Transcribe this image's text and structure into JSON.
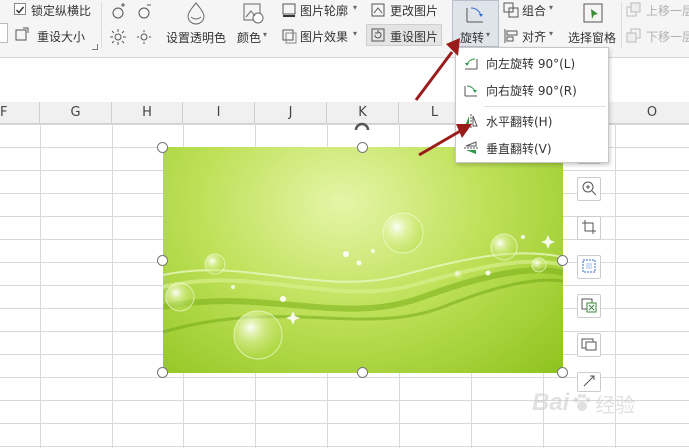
{
  "ribbon": {
    "lock_ratio_label": "锁定纵横比",
    "reset_size_label": "重设大小",
    "set_transparent_label": "设置透明色",
    "color_label": "颜色",
    "picture_outline_label": "图片轮廓",
    "picture_effect_label": "图片效果",
    "change_picture_label": "更改图片",
    "reset_picture_label": "重设图片",
    "rotate_label": "旋转",
    "group_label": "组合",
    "align_label": "对齐",
    "selection_pane_label": "选择窗格",
    "bring_forward_label": "上移一层",
    "send_backward_label": "下移一层"
  },
  "columns": [
    "F",
    "G",
    "H",
    "I",
    "J",
    "K",
    "L",
    "O"
  ],
  "rotate_menu": {
    "items": [
      {
        "label": "向左旋转 90°(L)",
        "icon": "rotate-left-icon"
      },
      {
        "label": "向右旋转 90°(R)",
        "icon": "rotate-right-icon"
      },
      {
        "label": "水平翻转(H)",
        "icon": "flip-horizontal-icon"
      },
      {
        "label": "垂直翻转(V)",
        "icon": "flip-vertical-icon"
      }
    ]
  },
  "watermark": {
    "text": "Bai",
    "suffix": "经验"
  },
  "colors": {
    "arrow": "#9b1b1b",
    "image_green": "#9ccc2a",
    "accent": "#3c8a3c"
  }
}
